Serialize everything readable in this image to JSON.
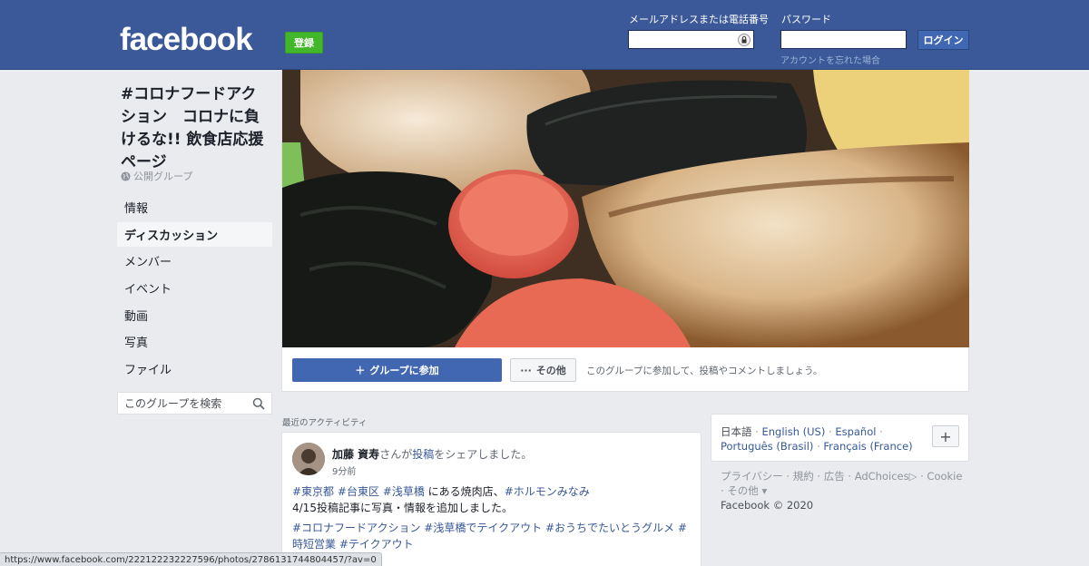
{
  "header": {
    "logo_text": "facebook",
    "signup_label": "登録",
    "email_label": "メールアドレスまたは電話番号",
    "password_label": "パスワード",
    "login_label": "ログイン",
    "forgot_link": "アカウントを忘れた場合",
    "email_value": "",
    "password_value": ""
  },
  "group": {
    "title": "#コロナフードアクション　コロナに負けるな!! 飲食店応援ページ",
    "type": "公開グループ"
  },
  "nav": {
    "items": [
      {
        "label": "情報",
        "active": false
      },
      {
        "label": "ディスカッション",
        "active": true
      },
      {
        "label": "メンバー",
        "active": false
      },
      {
        "label": "イベント",
        "active": false
      },
      {
        "label": "動画",
        "active": false
      },
      {
        "label": "写真",
        "active": false
      },
      {
        "label": "ファイル",
        "active": false
      }
    ]
  },
  "search": {
    "placeholder": "このグループを検索",
    "value": ""
  },
  "actions": {
    "join_label": "グループに参加",
    "more_label": "その他",
    "prompt": "このグループに参加して、投稿やコメントしましょう。"
  },
  "activity": {
    "heading": "最近のアクティビティ"
  },
  "post": {
    "author": "加藤 資寿",
    "action_prefix": "さんが",
    "action_link": "投稿",
    "action_suffix": "をシェアしました。",
    "time": "9分前",
    "location_tags": [
      "#東京都",
      "#台東区",
      "#浅草橋"
    ],
    "location_text": "にある焼肉店、",
    "shop_tag": "#ホルモンみなみ",
    "line2": "4/15投稿記事に写真・情報を追加しました。",
    "tags": [
      "#コロナフードアクション",
      "#浅草橋でテイクアウト",
      "#おうちでたいとうグルメ",
      "#時短営業",
      "#テイクアウト"
    ]
  },
  "languages": {
    "current": "日本語",
    "options": [
      "English (US)",
      "Español",
      "Português (Brasil)",
      "Français (France)"
    ],
    "add_label": "+"
  },
  "footer": {
    "links": [
      "プライバシー",
      "規約",
      "広告",
      "AdChoices",
      "Cookie",
      "その他"
    ],
    "copyright": "Facebook © 2020"
  },
  "status_bar": {
    "url": "https://www.facebook.com/222122232227596/photos/2786131744804457/?av=0"
  },
  "colors": {
    "brand": "#3b5998",
    "signup": "#42b72a",
    "link": "#385898",
    "background": "#e9ebee"
  },
  "icons": [
    "lock-icon",
    "globe-icon",
    "search-icon",
    "plus-icon",
    "more-dots-icon",
    "adchoices-icon"
  ]
}
